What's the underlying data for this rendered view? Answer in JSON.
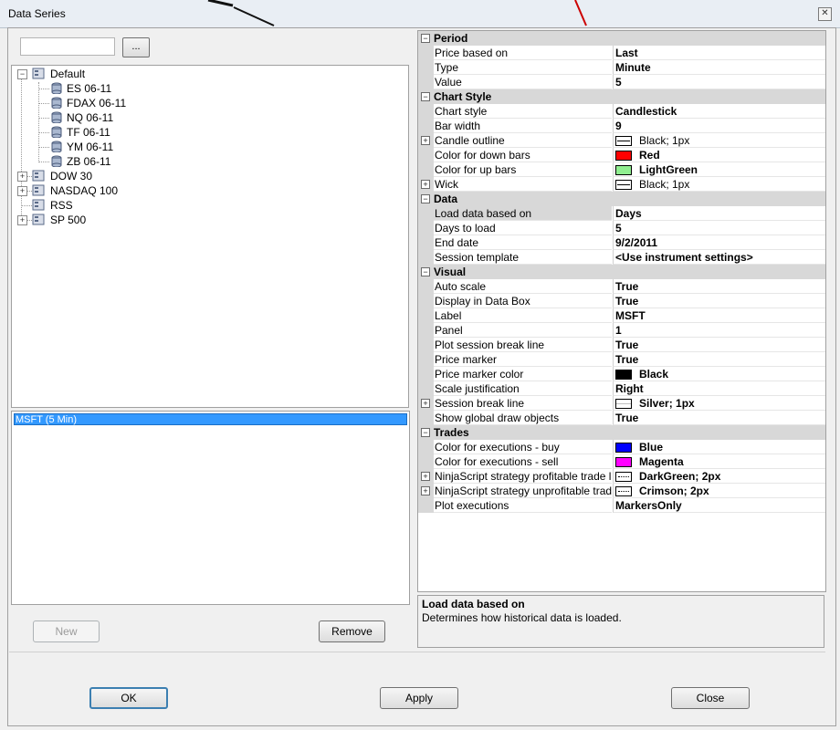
{
  "window": {
    "title": "Data Series"
  },
  "search": {
    "value": "",
    "browse_label": "..."
  },
  "tree": [
    {
      "label": "Default",
      "expanded": true,
      "children": [
        "ES 06-11",
        "FDAX 06-11",
        "NQ 06-11",
        "TF 06-11",
        "YM 06-11",
        "ZB 06-11"
      ]
    },
    {
      "label": "DOW 30",
      "expanded": false
    },
    {
      "label": "NASDAQ 100",
      "expanded": false
    },
    {
      "label": "RSS",
      "expanded": null
    },
    {
      "label": "SP 500",
      "expanded": false
    }
  ],
  "series_list": {
    "items": [
      "MSFT (5 Min)"
    ],
    "selected": "MSFT (5 Min)"
  },
  "left_buttons": {
    "new_label": "New",
    "remove_label": "Remove"
  },
  "properties": {
    "categories": [
      {
        "label": "Period",
        "rows": [
          {
            "name": "Price based on",
            "value": "Last"
          },
          {
            "name": "Type",
            "value": "Minute"
          },
          {
            "name": "Value",
            "value": "5"
          }
        ]
      },
      {
        "label": "Chart Style",
        "rows": [
          {
            "name": "Chart style",
            "value": "Candlestick"
          },
          {
            "name": "Bar width",
            "value": "9"
          },
          {
            "name": "Candle outline",
            "value": "Black; 1px",
            "expandable": true,
            "swatch": "line",
            "light": true
          },
          {
            "name": "Color for down bars",
            "value": "Red",
            "swatch_color": "#ff0000"
          },
          {
            "name": "Color for up bars",
            "value": "LightGreen",
            "swatch_color": "#90ee90"
          },
          {
            "name": "Wick",
            "value": "Black; 1px",
            "expandable": true,
            "swatch": "line",
            "light": true
          }
        ]
      },
      {
        "label": "Data",
        "rows": [
          {
            "name": "Load data based on",
            "value": "Days",
            "selected": true
          },
          {
            "name": "Days to load",
            "value": "5"
          },
          {
            "name": "End date",
            "value": "9/2/2011"
          },
          {
            "name": "Session template",
            "value": "<Use instrument settings>"
          }
        ]
      },
      {
        "label": "Visual",
        "rows": [
          {
            "name": "Auto scale",
            "value": "True"
          },
          {
            "name": "Display in Data Box",
            "value": "True"
          },
          {
            "name": "Label",
            "value": "MSFT"
          },
          {
            "name": "Panel",
            "value": "1"
          },
          {
            "name": "Plot session break line",
            "value": "True"
          },
          {
            "name": "Price marker",
            "value": "True"
          },
          {
            "name": "Price marker color",
            "value": "Black",
            "swatch_color": "#000000"
          },
          {
            "name": "Scale justification",
            "value": "Right"
          },
          {
            "name": "Session break line",
            "value": "Silver; 1px",
            "expandable": true,
            "swatch": "silver"
          },
          {
            "name": "Show global draw objects",
            "value": "True"
          }
        ]
      },
      {
        "label": "Trades",
        "rows": [
          {
            "name": "Color for executions - buy",
            "value": "Blue",
            "swatch_color": "#0000ff"
          },
          {
            "name": "Color for executions - sell",
            "value": "Magenta",
            "swatch_color": "#ff00ff"
          },
          {
            "name": "NinjaScript strategy profitable trade lines",
            "value": "DarkGreen; 2px",
            "expandable": true,
            "swatch": "dotted"
          },
          {
            "name": "NinjaScript strategy unprofitable trade lines",
            "value": "Crimson; 2px",
            "expandable": true,
            "swatch": "dotted"
          },
          {
            "name": "Plot executions",
            "value": "MarkersOnly"
          }
        ]
      }
    ]
  },
  "description": {
    "title": "Load data based on",
    "text": "Determines how historical data is loaded."
  },
  "dialog_buttons": {
    "ok_label": "OK",
    "apply_label": "Apply",
    "close_label": "Close"
  }
}
